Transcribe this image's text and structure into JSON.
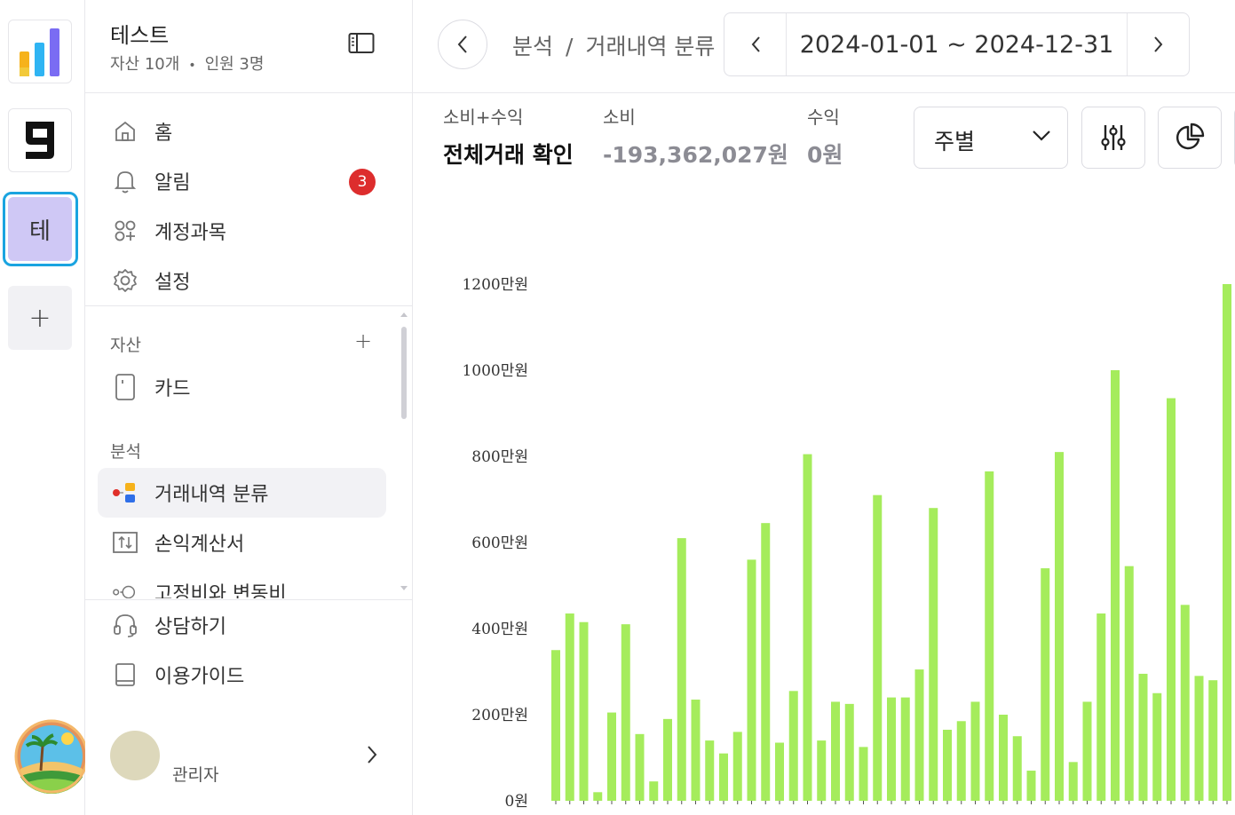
{
  "rail": {
    "workspaces": [
      {
        "name": "chart-app-logo"
      },
      {
        "name": "g-app-logo",
        "glyph": "g"
      },
      {
        "name": "test-workspace",
        "initial": "테"
      }
    ],
    "add_label": "+"
  },
  "sidebar": {
    "org_name": "테스트",
    "assets_count": "자산 10개",
    "members_count": "인원 3명",
    "nav": [
      {
        "label": "홈",
        "icon": "home-icon"
      },
      {
        "label": "알림",
        "icon": "bell-icon",
        "badge": "3"
      },
      {
        "label": "계정과목",
        "icon": "categories-icon"
      },
      {
        "label": "설정",
        "icon": "gear-icon"
      }
    ],
    "assets_section": "자산",
    "assets_add": "+",
    "assets_items": [
      {
        "label": "카드",
        "icon": "card-icon"
      }
    ],
    "analysis_section": "분석",
    "analysis_items": [
      {
        "label": "거래내역 분류",
        "icon": "classify-icon",
        "active": true
      },
      {
        "label": "손익계산서",
        "icon": "income-statement-icon"
      },
      {
        "label": "고정비와 변동비",
        "icon": "fixed-variable-icon"
      }
    ],
    "footer_items": [
      {
        "label": "상담하기",
        "icon": "headset-icon"
      },
      {
        "label": "이용가이드",
        "icon": "book-icon"
      }
    ],
    "user_role": "관리자"
  },
  "header": {
    "breadcrumb": [
      "분석",
      "거래내역 분류"
    ],
    "breadcrumb_sep": "/",
    "date_range": "2024-01-01 ~ 2024-12-31"
  },
  "summary": {
    "stats": [
      {
        "key": "소비+수익",
        "value": "전체거래 확인"
      },
      {
        "key": "소비",
        "value": "-193,362,027원"
      },
      {
        "key": "수익",
        "value": "0원"
      }
    ]
  },
  "controls": {
    "period": "주별"
  },
  "colors": {
    "bar": "#a5ec5c",
    "badge": "#dd2d2d",
    "selected_ring": "#1aa4e0",
    "workspace_bg": "#cfc8f5"
  },
  "chart_data": {
    "type": "bar",
    "ylabel": "",
    "y_ticks": [
      "0원",
      "200만원",
      "400만원",
      "600만원",
      "800만원",
      "1000만원",
      "1200만원"
    ],
    "ylim": [
      0,
      12000000
    ],
    "grid": false,
    "values": [
      3500000,
      4350000,
      4150000,
      200000,
      2050000,
      4100000,
      1550000,
      450000,
      1900000,
      6100000,
      2350000,
      1400000,
      1100000,
      1600000,
      5600000,
      6450000,
      1350000,
      2550000,
      8050000,
      1400000,
      2300000,
      2250000,
      1250000,
      7100000,
      2400000,
      2400000,
      3050000,
      6800000,
      1650000,
      1850000,
      2300000,
      7650000,
      2000000,
      1500000,
      700000,
      5400000,
      8100000,
      900000,
      2300000,
      4350000,
      10000000,
      5450000,
      2950000,
      2500000,
      9350000,
      4550000,
      2900000,
      2800000,
      12000000
    ]
  }
}
